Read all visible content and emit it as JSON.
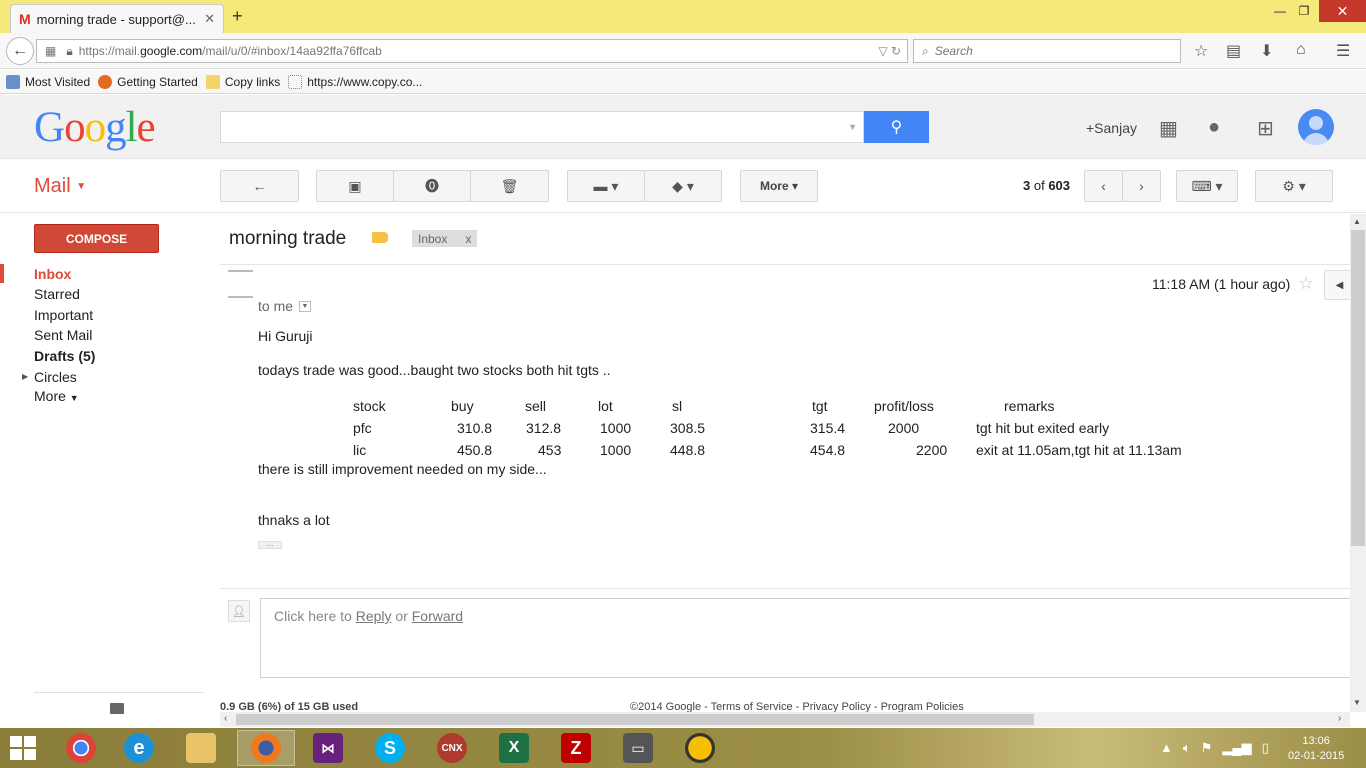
{
  "browser": {
    "tab_title": "morning trade - support@...",
    "tab_close": "✕",
    "url_prefix": "https://mail.",
    "url_domain": "google.com",
    "url_rest": "/mail/u/0/#inbox/14aa92ffa76ffcab",
    "search_placeholder": "Search",
    "bookmarks": [
      "Most Visited",
      "Getting Started",
      "Copy links",
      "https://www.copy.co..."
    ]
  },
  "gmail_header": {
    "logo": "Google",
    "user": "+Sanjay"
  },
  "toolbar": {
    "mail_label": "Mail",
    "more_label": "More",
    "page_current": "3",
    "page_of": "of",
    "page_total": "603"
  },
  "nav": {
    "compose": "COMPOSE",
    "items": [
      "Inbox",
      "Starred",
      "Important",
      "Sent Mail",
      "Drafts (5)",
      "Circles",
      "More"
    ]
  },
  "message": {
    "subject": "morning trade",
    "label": "Inbox",
    "label_remove": "x",
    "to": "to me",
    "time": "11:18 AM (1 hour ago)",
    "greeting": "Hi Guruji",
    "line1": "todays trade was good...baught two stocks both hit tgts ..",
    "line2": "there is still improvement needed on my side...",
    "line3": "thnaks a lot",
    "table": {
      "headers": [
        "stock",
        "buy",
        "sell",
        "lot",
        "sl",
        "tgt",
        "profit/loss",
        "remarks"
      ],
      "rows": [
        [
          "pfc",
          "310.8",
          "312.8",
          "1000",
          "308.5",
          "315.4",
          "2000",
          "tgt hit but exited early"
        ],
        [
          "lic",
          "450.8",
          "453",
          "1000",
          "448.8",
          "454.8",
          "2200",
          "exit at 11.05am,tgt hit at 11.13am"
        ]
      ]
    }
  },
  "reply": {
    "prefix": "Click here to ",
    "reply": "Reply",
    "or": " or ",
    "forward": "Forward"
  },
  "footer": {
    "storage": "0.9 GB (6%) of 15 GB used",
    "legal": "©2014 Google - Terms of Service - Privacy Policy - Program Policies"
  },
  "taskbar": {
    "time": "13:06",
    "date": "02-01-2015"
  }
}
